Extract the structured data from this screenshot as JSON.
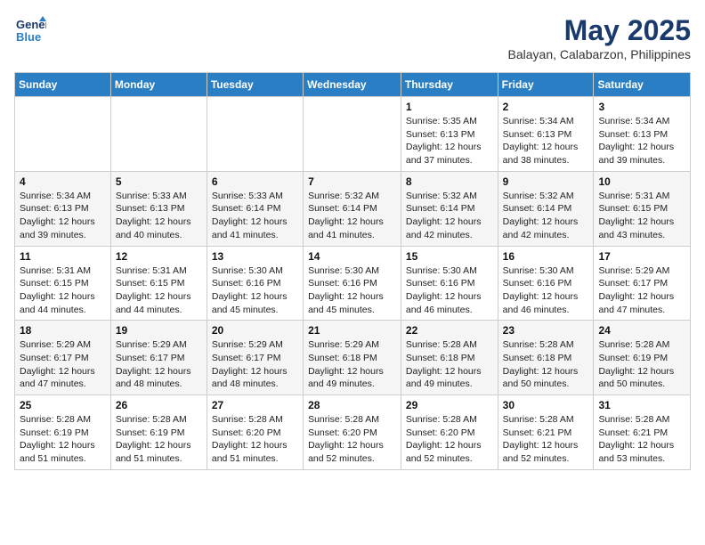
{
  "header": {
    "logo_line1": "General",
    "logo_line2": "Blue",
    "main_title": "May 2025",
    "subtitle": "Balayan, Calabarzon, Philippines"
  },
  "days_of_week": [
    "Sunday",
    "Monday",
    "Tuesday",
    "Wednesday",
    "Thursday",
    "Friday",
    "Saturday"
  ],
  "weeks": [
    [
      {
        "day": "",
        "sunrise": "",
        "sunset": "",
        "daylight": ""
      },
      {
        "day": "",
        "sunrise": "",
        "sunset": "",
        "daylight": ""
      },
      {
        "day": "",
        "sunrise": "",
        "sunset": "",
        "daylight": ""
      },
      {
        "day": "",
        "sunrise": "",
        "sunset": "",
        "daylight": ""
      },
      {
        "day": "1",
        "sunrise": "Sunrise: 5:35 AM",
        "sunset": "Sunset: 6:13 PM",
        "daylight": "Daylight: 12 hours and 37 minutes."
      },
      {
        "day": "2",
        "sunrise": "Sunrise: 5:34 AM",
        "sunset": "Sunset: 6:13 PM",
        "daylight": "Daylight: 12 hours and 38 minutes."
      },
      {
        "day": "3",
        "sunrise": "Sunrise: 5:34 AM",
        "sunset": "Sunset: 6:13 PM",
        "daylight": "Daylight: 12 hours and 39 minutes."
      }
    ],
    [
      {
        "day": "4",
        "sunrise": "Sunrise: 5:34 AM",
        "sunset": "Sunset: 6:13 PM",
        "daylight": "Daylight: 12 hours and 39 minutes."
      },
      {
        "day": "5",
        "sunrise": "Sunrise: 5:33 AM",
        "sunset": "Sunset: 6:13 PM",
        "daylight": "Daylight: 12 hours and 40 minutes."
      },
      {
        "day": "6",
        "sunrise": "Sunrise: 5:33 AM",
        "sunset": "Sunset: 6:14 PM",
        "daylight": "Daylight: 12 hours and 41 minutes."
      },
      {
        "day": "7",
        "sunrise": "Sunrise: 5:32 AM",
        "sunset": "Sunset: 6:14 PM",
        "daylight": "Daylight: 12 hours and 41 minutes."
      },
      {
        "day": "8",
        "sunrise": "Sunrise: 5:32 AM",
        "sunset": "Sunset: 6:14 PM",
        "daylight": "Daylight: 12 hours and 42 minutes."
      },
      {
        "day": "9",
        "sunrise": "Sunrise: 5:32 AM",
        "sunset": "Sunset: 6:14 PM",
        "daylight": "Daylight: 12 hours and 42 minutes."
      },
      {
        "day": "10",
        "sunrise": "Sunrise: 5:31 AM",
        "sunset": "Sunset: 6:15 PM",
        "daylight": "Daylight: 12 hours and 43 minutes."
      }
    ],
    [
      {
        "day": "11",
        "sunrise": "Sunrise: 5:31 AM",
        "sunset": "Sunset: 6:15 PM",
        "daylight": "Daylight: 12 hours and 44 minutes."
      },
      {
        "day": "12",
        "sunrise": "Sunrise: 5:31 AM",
        "sunset": "Sunset: 6:15 PM",
        "daylight": "Daylight: 12 hours and 44 minutes."
      },
      {
        "day": "13",
        "sunrise": "Sunrise: 5:30 AM",
        "sunset": "Sunset: 6:16 PM",
        "daylight": "Daylight: 12 hours and 45 minutes."
      },
      {
        "day": "14",
        "sunrise": "Sunrise: 5:30 AM",
        "sunset": "Sunset: 6:16 PM",
        "daylight": "Daylight: 12 hours and 45 minutes."
      },
      {
        "day": "15",
        "sunrise": "Sunrise: 5:30 AM",
        "sunset": "Sunset: 6:16 PM",
        "daylight": "Daylight: 12 hours and 46 minutes."
      },
      {
        "day": "16",
        "sunrise": "Sunrise: 5:30 AM",
        "sunset": "Sunset: 6:16 PM",
        "daylight": "Daylight: 12 hours and 46 minutes."
      },
      {
        "day": "17",
        "sunrise": "Sunrise: 5:29 AM",
        "sunset": "Sunset: 6:17 PM",
        "daylight": "Daylight: 12 hours and 47 minutes."
      }
    ],
    [
      {
        "day": "18",
        "sunrise": "Sunrise: 5:29 AM",
        "sunset": "Sunset: 6:17 PM",
        "daylight": "Daylight: 12 hours and 47 minutes."
      },
      {
        "day": "19",
        "sunrise": "Sunrise: 5:29 AM",
        "sunset": "Sunset: 6:17 PM",
        "daylight": "Daylight: 12 hours and 48 minutes."
      },
      {
        "day": "20",
        "sunrise": "Sunrise: 5:29 AM",
        "sunset": "Sunset: 6:17 PM",
        "daylight": "Daylight: 12 hours and 48 minutes."
      },
      {
        "day": "21",
        "sunrise": "Sunrise: 5:29 AM",
        "sunset": "Sunset: 6:18 PM",
        "daylight": "Daylight: 12 hours and 49 minutes."
      },
      {
        "day": "22",
        "sunrise": "Sunrise: 5:28 AM",
        "sunset": "Sunset: 6:18 PM",
        "daylight": "Daylight: 12 hours and 49 minutes."
      },
      {
        "day": "23",
        "sunrise": "Sunrise: 5:28 AM",
        "sunset": "Sunset: 6:18 PM",
        "daylight": "Daylight: 12 hours and 50 minutes."
      },
      {
        "day": "24",
        "sunrise": "Sunrise: 5:28 AM",
        "sunset": "Sunset: 6:19 PM",
        "daylight": "Daylight: 12 hours and 50 minutes."
      }
    ],
    [
      {
        "day": "25",
        "sunrise": "Sunrise: 5:28 AM",
        "sunset": "Sunset: 6:19 PM",
        "daylight": "Daylight: 12 hours and 51 minutes."
      },
      {
        "day": "26",
        "sunrise": "Sunrise: 5:28 AM",
        "sunset": "Sunset: 6:19 PM",
        "daylight": "Daylight: 12 hours and 51 minutes."
      },
      {
        "day": "27",
        "sunrise": "Sunrise: 5:28 AM",
        "sunset": "Sunset: 6:20 PM",
        "daylight": "Daylight: 12 hours and 51 minutes."
      },
      {
        "day": "28",
        "sunrise": "Sunrise: 5:28 AM",
        "sunset": "Sunset: 6:20 PM",
        "daylight": "Daylight: 12 hours and 52 minutes."
      },
      {
        "day": "29",
        "sunrise": "Sunrise: 5:28 AM",
        "sunset": "Sunset: 6:20 PM",
        "daylight": "Daylight: 12 hours and 52 minutes."
      },
      {
        "day": "30",
        "sunrise": "Sunrise: 5:28 AM",
        "sunset": "Sunset: 6:21 PM",
        "daylight": "Daylight: 12 hours and 52 minutes."
      },
      {
        "day": "31",
        "sunrise": "Sunrise: 5:28 AM",
        "sunset": "Sunset: 6:21 PM",
        "daylight": "Daylight: 12 hours and 53 minutes."
      }
    ]
  ]
}
